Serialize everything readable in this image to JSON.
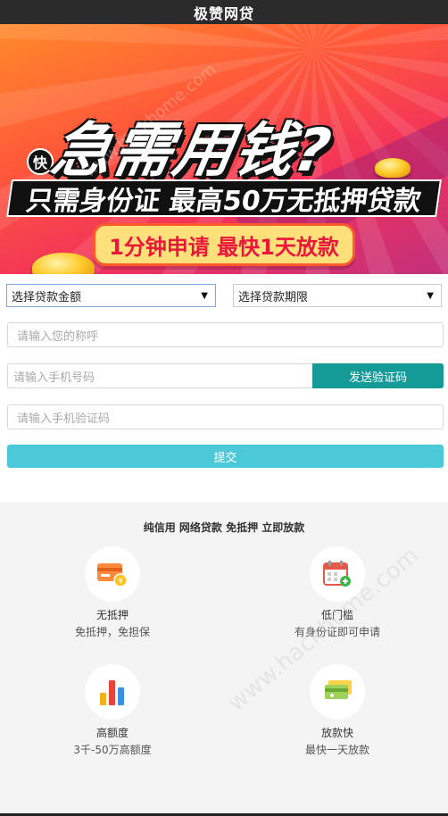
{
  "app": {
    "title": "极赞网贷"
  },
  "banner": {
    "badge": "快",
    "headline": "急需用钱?",
    "subline": "只需身份证 最高50万无抵押贷款",
    "pill": "1分钟申请 最快1天放款"
  },
  "form": {
    "amount_select": "选择贷款金额",
    "term_select": "选择贷款期限",
    "name_placeholder": "请输入您的称呼",
    "phone_placeholder": "请输入手机号码",
    "send_code": "发送验证码",
    "code_placeholder": "请输入手机验证码",
    "submit": "提交"
  },
  "features": {
    "heading": "纯信用 网络贷款 免抵押 立即放款",
    "items": [
      {
        "title": "无抵押",
        "desc": "免抵押，免担保",
        "icon": "card-coin-icon"
      },
      {
        "title": "低门槛",
        "desc": "有身份证即可申请",
        "icon": "calendar-plus-icon"
      },
      {
        "title": "高额度",
        "desc": "3千-50万高额度",
        "icon": "bar-chart-icon"
      },
      {
        "title": "放款快",
        "desc": "最快一天放款",
        "icon": "cash-icon"
      }
    ]
  },
  "watermark": "www.hackhome.com"
}
